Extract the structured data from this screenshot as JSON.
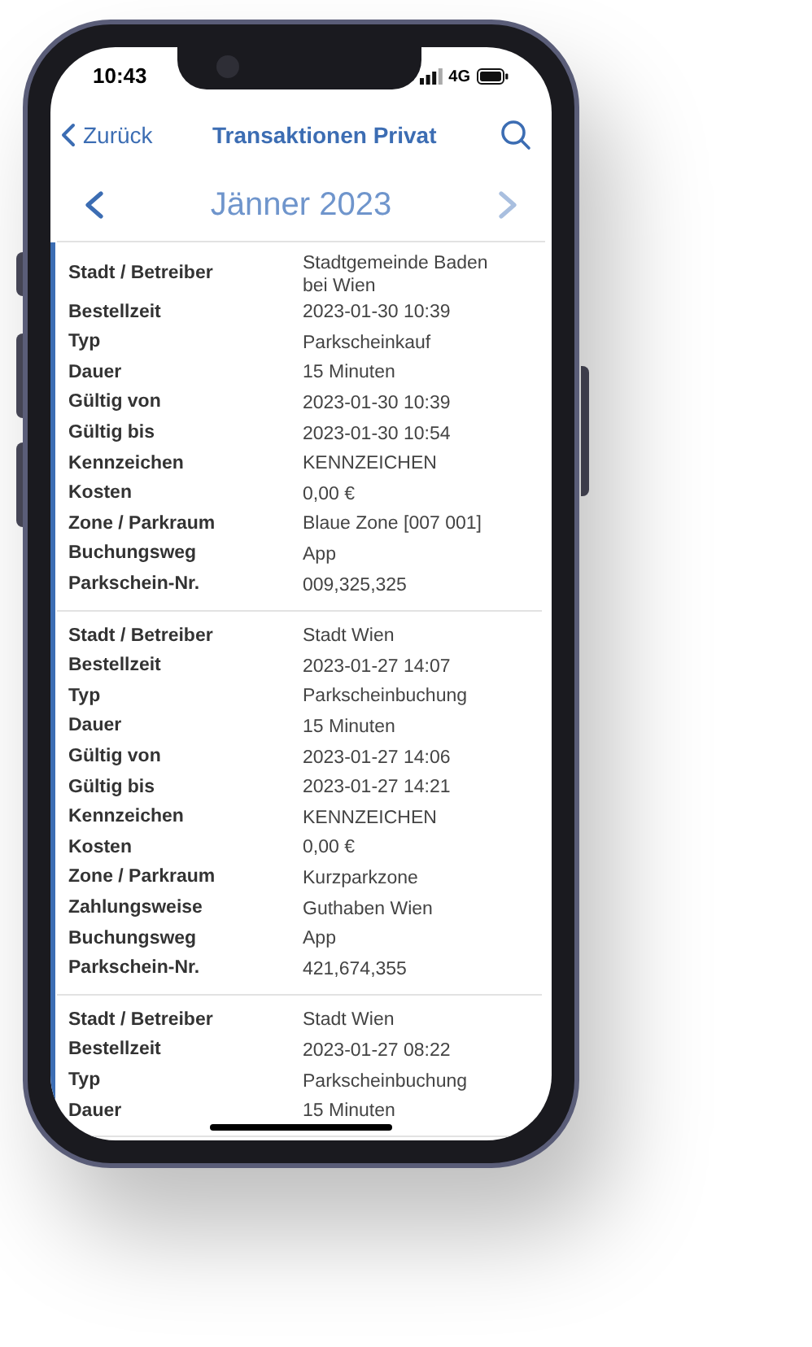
{
  "status_bar": {
    "time": "10:43",
    "network": "4G"
  },
  "nav_bar": {
    "back": "Zurück",
    "title": "Transaktionen Privat"
  },
  "month_bar": {
    "month": "Jänner 2023",
    "prev_disabled": false,
    "next_disabled": true
  },
  "transactions": [
    {
      "rows": [
        {
          "label": "Stadt / Betreiber",
          "value": "Stadtgemeinde Baden bei Wien"
        },
        {
          "label": "Bestellzeit",
          "value": "2023-01-30 10:39"
        },
        {
          "label": "Typ",
          "value": "Parkscheinkauf"
        },
        {
          "label": "Dauer",
          "value": "15 Minuten"
        },
        {
          "label": "Gültig von",
          "value": "2023-01-30 10:39"
        },
        {
          "label": "Gültig bis",
          "value": "2023-01-30 10:54"
        },
        {
          "label": "Kennzeichen",
          "value": "KENNZEICHEN"
        },
        {
          "label": "Kosten",
          "value": "0,00 €"
        },
        {
          "label": "Zone / Parkraum",
          "value": "Blaue Zone [007 001]"
        },
        {
          "label": "Buchungsweg",
          "value": "App"
        },
        {
          "label": "Parkschein-Nr.",
          "value": "009,325,325"
        }
      ]
    },
    {
      "rows": [
        {
          "label": "Stadt / Betreiber",
          "value": "Stadt Wien"
        },
        {
          "label": "Bestellzeit",
          "value": "2023-01-27 14:07"
        },
        {
          "label": "Typ",
          "value": "Parkscheinbuchung"
        },
        {
          "label": "Dauer",
          "value": "15 Minuten"
        },
        {
          "label": "Gültig von",
          "value": "2023-01-27 14:06"
        },
        {
          "label": "Gültig bis",
          "value": "2023-01-27 14:21"
        },
        {
          "label": "Kennzeichen",
          "value": "KENNZEICHEN"
        },
        {
          "label": "Kosten",
          "value": "0,00 €"
        },
        {
          "label": "Zone / Parkraum",
          "value": "Kurzparkzone"
        },
        {
          "label": "Zahlungsweise",
          "value": "Guthaben Wien"
        },
        {
          "label": "Buchungsweg",
          "value": "App"
        },
        {
          "label": "Parkschein-Nr.",
          "value": "421,674,355"
        }
      ]
    },
    {
      "rows": [
        {
          "label": "Stadt / Betreiber",
          "value": "Stadt Wien"
        },
        {
          "label": "Bestellzeit",
          "value": "2023-01-27 08:22"
        },
        {
          "label": "Typ",
          "value": "Parkscheinbuchung"
        },
        {
          "label": "Dauer",
          "value": "15 Minuten"
        }
      ]
    }
  ]
}
